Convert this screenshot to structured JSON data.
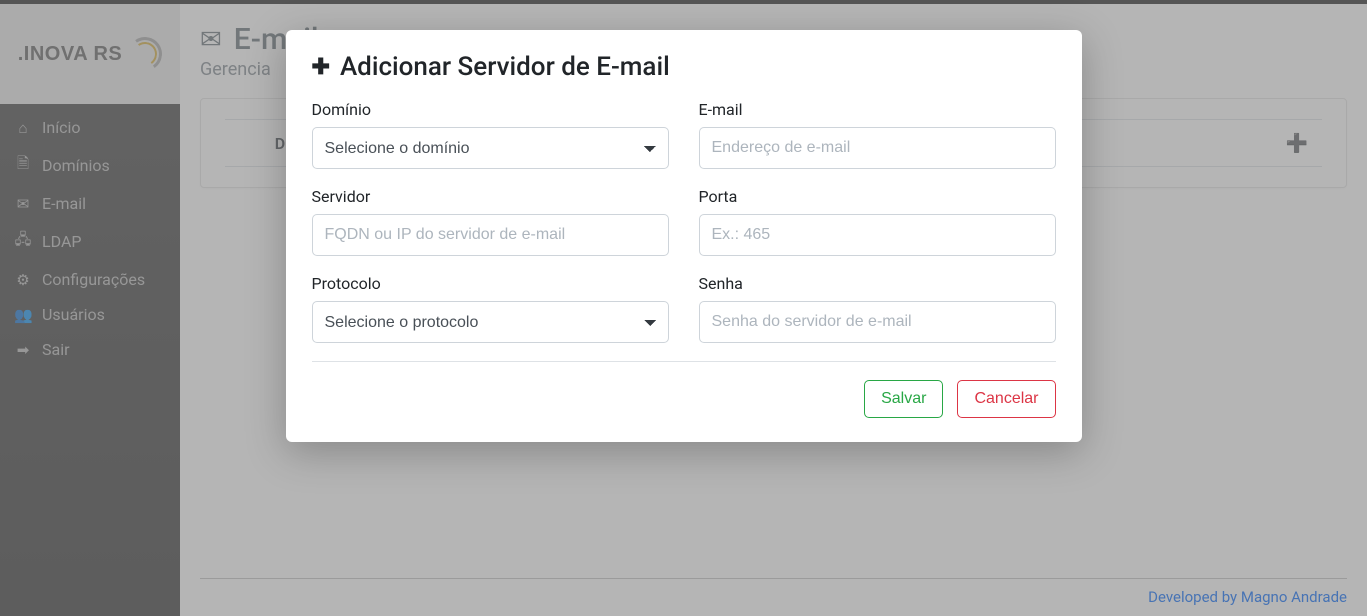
{
  "brand": {
    "text": ".INOVA RS"
  },
  "sidebar": {
    "items": [
      {
        "label": "Início",
        "icon": "home-icon"
      },
      {
        "label": "Domínios",
        "icon": "file-icon"
      },
      {
        "label": "E-mail",
        "icon": "mail-icon"
      },
      {
        "label": "LDAP",
        "icon": "sitemap-icon"
      },
      {
        "label": "Configurações",
        "icon": "cogs-icon"
      },
      {
        "label": "Usuários",
        "icon": "users-icon"
      },
      {
        "label": "Sair",
        "icon": "exit-icon"
      }
    ]
  },
  "page": {
    "title": "E-mail",
    "subtitle_prefix": "Gerencia"
  },
  "table": {
    "first_col_initial": "D"
  },
  "footer": {
    "text": "Developed by Magno Andrade"
  },
  "modal": {
    "title": "Adicionar Servidor de E-mail",
    "fields": {
      "dominio": {
        "label": "Domínio",
        "placeholder": "Selecione o domínio"
      },
      "email": {
        "label": "E-mail",
        "placeholder": "Endereço de e-mail"
      },
      "servidor": {
        "label": "Servidor",
        "placeholder": "FQDN ou IP do servidor de e-mail"
      },
      "porta": {
        "label": "Porta",
        "placeholder": "Ex.: 465"
      },
      "protocolo": {
        "label": "Protocolo",
        "placeholder": "Selecione o protocolo"
      },
      "senha": {
        "label": "Senha",
        "placeholder": "Senha do servidor de e-mail"
      }
    },
    "buttons": {
      "save": "Salvar",
      "cancel": "Cancelar"
    }
  }
}
